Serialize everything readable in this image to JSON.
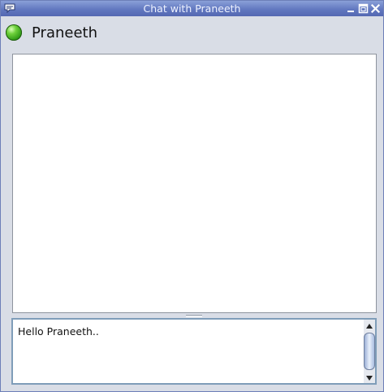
{
  "window": {
    "title": "Chat with Praneeth"
  },
  "contact": {
    "name": "Praneeth",
    "status": "online",
    "status_color": "#3aa81e"
  },
  "history": {
    "messages": []
  },
  "compose": {
    "value": "Hello Praneeth.."
  },
  "icons": {
    "app": "chat-bubble-icon",
    "minimize": "minimize-icon",
    "maximize": "maximize-icon",
    "close": "close-icon",
    "status": "status-online-icon",
    "scroll_up": "scroll-up-icon",
    "scroll_down": "scroll-down-icon"
  },
  "colors": {
    "titlebar": "#6278c0",
    "window_bg": "#d9dde6",
    "input_border": "#7f9db9"
  }
}
